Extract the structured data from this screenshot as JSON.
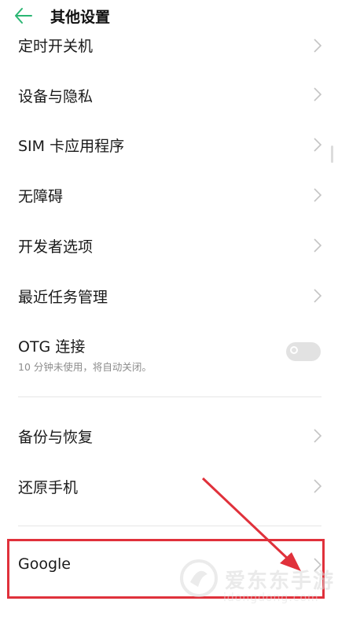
{
  "header": {
    "title": "其他设置",
    "back_icon": "arrow-left-icon",
    "accent": "#2bb673"
  },
  "items": [
    {
      "id": "timer-power",
      "label": "定时开关机"
    },
    {
      "id": "device-privacy",
      "label": "设备与隐私"
    },
    {
      "id": "sim-apps",
      "label": "SIM 卡应用程序"
    },
    {
      "id": "accessibility",
      "label": "无障碍"
    },
    {
      "id": "developer-options",
      "label": "开发者选项"
    },
    {
      "id": "recent-tasks",
      "label": "最近任务管理"
    },
    {
      "id": "otg",
      "label": "OTG 连接",
      "sublabel": "10 分钟未使用，将自动关闭。",
      "toggle": false
    },
    {
      "id": "backup-restore",
      "label": "备份与恢复"
    },
    {
      "id": "reset-phone",
      "label": "还原手机"
    },
    {
      "id": "google",
      "label": "Google"
    }
  ],
  "annotation": {
    "color": "#e0313b",
    "target": "google"
  },
  "watermark": {
    "text": "爱东东手游",
    "url": "idongdong.com"
  }
}
